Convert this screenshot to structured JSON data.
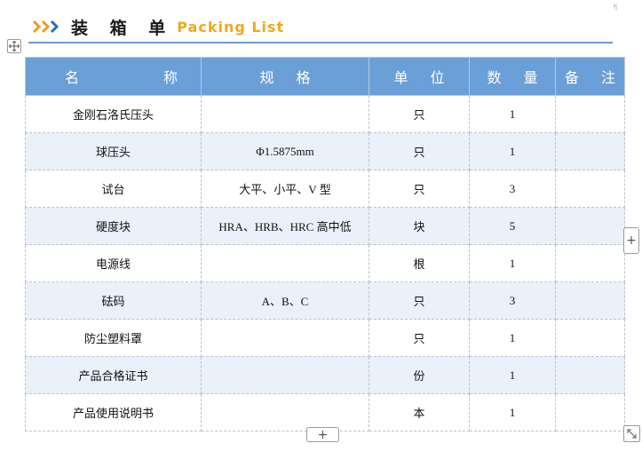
{
  "title": {
    "cn": "装 箱 单",
    "en": "Packing List",
    "en_color": "#f0a81c",
    "chevron_colors": [
      "#f29a1f",
      "#2a6cbf"
    ]
  },
  "icons": {
    "move": "move-arrows-icon",
    "add_column": "plus-icon",
    "add_row": "plus-icon",
    "resize": "diagonal-resize-icon"
  },
  "controls": {
    "add_column_label": "+",
    "add_row_label": "+"
  },
  "table": {
    "header_color": "#6a9fd8",
    "alt_row_color": "#eaf1fa",
    "headers": {
      "name_left": "名",
      "name_right": "称",
      "spec": "规 格",
      "unit": "单 位",
      "qty": "数 量",
      "note": "备 注"
    },
    "rows": [
      {
        "name": "金刚石洛氏压头",
        "spec": "",
        "unit": "只",
        "qty": "1",
        "note": ""
      },
      {
        "name": "球压头",
        "spec": "Φ1.5875mm",
        "unit": "只",
        "qty": "1",
        "note": ""
      },
      {
        "name": "试台",
        "spec": "大平、小平、V 型",
        "unit": "只",
        "qty": "3",
        "note": ""
      },
      {
        "name": "硬度块",
        "spec": "HRA、HRB、HRC 高中低",
        "unit": "块",
        "qty": "5",
        "note": ""
      },
      {
        "name": "电源线",
        "spec": "",
        "unit": "根",
        "qty": "1",
        "note": ""
      },
      {
        "name": "砝码",
        "spec": "A、B、C",
        "unit": "只",
        "qty": "3",
        "note": ""
      },
      {
        "name": "防尘塑料罩",
        "spec": "",
        "unit": "只",
        "qty": "1",
        "note": ""
      },
      {
        "name": "产品合格证书",
        "spec": "",
        "unit": "份",
        "qty": "1",
        "note": ""
      },
      {
        "name": "产品使用说明书",
        "spec": "",
        "unit": "本",
        "qty": "1",
        "note": ""
      }
    ]
  }
}
